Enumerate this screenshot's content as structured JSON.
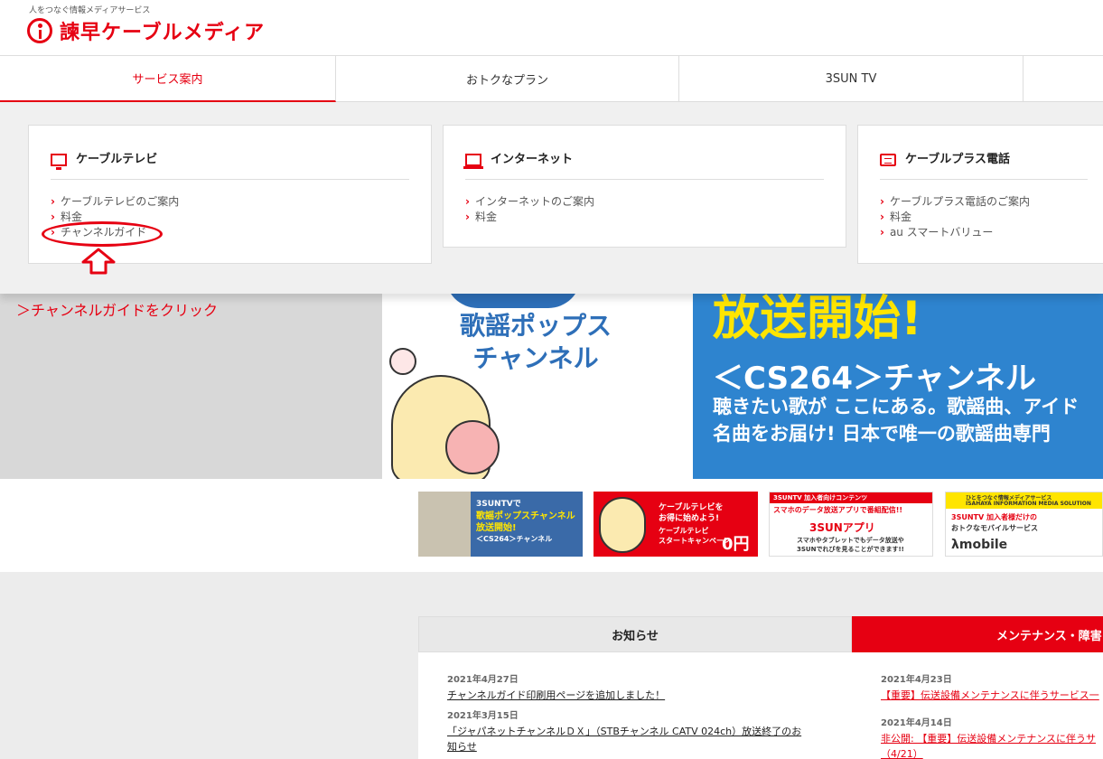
{
  "header": {
    "tagline": "人をつなぐ情報メディアサービス",
    "logo_text": "諫早ケーブルメディア"
  },
  "nav": {
    "tabs": [
      {
        "label": "サービス案内",
        "active": true
      },
      {
        "label": "おトクなプラン"
      },
      {
        "label": "3SUN TV"
      },
      {
        "label": ""
      }
    ]
  },
  "dropdown": {
    "cards": [
      {
        "title": "ケーブルテレビ",
        "icon": "tv-icon",
        "links": [
          "ケーブルテレビのご案内",
          "料金",
          "チャンネルガイド"
        ]
      },
      {
        "title": "インターネット",
        "icon": "laptop-icon",
        "links": [
          "インターネットのご案内",
          "料金"
        ]
      },
      {
        "title": "ケーブルプラス電話",
        "icon": "phone-icon",
        "links": [
          "ケーブルプラス電話のご案内",
          "料金",
          "au スマートバリュー"
        ]
      }
    ]
  },
  "annotation": {
    "instruction": "＞チャンネルガイドをクリック"
  },
  "hero": {
    "channel_title_1": "歌謡ポップス",
    "channel_title_2": "チャンネル",
    "headline": "放送開始!",
    "channel_no": "＜CS264＞チャンネル",
    "desc_1": "聴きたい歌が ここにある。歌謡曲、アイド",
    "desc_2": "名曲をお届け! 日本で唯一の歌謡曲専門"
  },
  "banners": [
    {
      "line1": "3SUNTVで",
      "line2": "歌謡ポップスチャンネル",
      "line3": "放送開始!",
      "line4": "＜CS264＞チャンネル"
    },
    {
      "line1": "ケーブルテレビを",
      "line2": "お得に始めよう!",
      "line3": "ケーブルテレビ",
      "line4": "スタートキャンペーン",
      "price": "0円"
    },
    {
      "line1": "3SUNTV 加入者向けコンテンツ",
      "line2": "スマホのデータ放送アプリで番組配信!!",
      "line3": "3SUNアプリ",
      "line4": "スマホやタブレットでもデータ放送や",
      "line5": "3SUNでれびを見ることができます!!"
    },
    {
      "line1": "ひとをつなぐ情報メディアサービス",
      "line2": "ISAHAYA INFORMATION MEDIA SOLUTION",
      "line3": "3SUNTV 加入者様だけの",
      "line4": "おトクなモバイルサービス",
      "line5": "λmobile"
    }
  ],
  "news": {
    "title": "お知らせ",
    "items": [
      {
        "date": "2021年4月27日",
        "text": "チャンネルガイド印刷用ページを追加しました！"
      },
      {
        "date": "2021年3月15日",
        "text": "「ジャパネットチャンネルＤＸ」（STBチャンネル CATV 024ch）放送終了のお",
        "text2": "知らせ"
      }
    ]
  },
  "maintenance": {
    "title": "メンテナンス・障害",
    "items": [
      {
        "date": "2021年4月23日",
        "text": "【重要】伝送設備メンテナンスに伴うサービス一"
      },
      {
        "date": "2021年4月14日",
        "text": "非公開: 【重要】伝送設備メンテナンスに伴うサ",
        "text2": "（4/21）"
      }
    ]
  },
  "colors": {
    "brand": "#e60012",
    "hero_blue": "#2e84cf",
    "hero_yellow": "#ffe500"
  }
}
